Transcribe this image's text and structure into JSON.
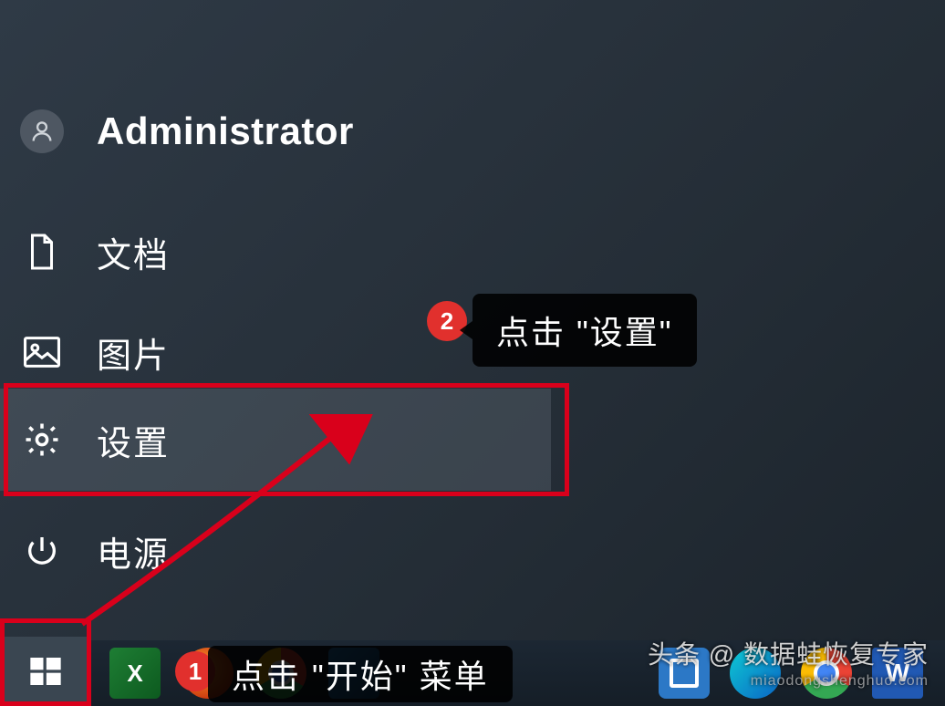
{
  "start_menu": {
    "user_label": "Administrator",
    "items": {
      "documents": "文档",
      "pictures": "图片",
      "settings": "设置",
      "power": "电源"
    }
  },
  "annotations": {
    "step1": {
      "number": "1",
      "text": "点击 \"开始\" 菜单"
    },
    "step2": {
      "number": "2",
      "text": "点击 \"设置\""
    },
    "highlight_color": "#d9001b"
  },
  "watermark": {
    "line1": "头条 @ 数据蛙恢复专家",
    "line2": "miaodongshenghuo.com"
  },
  "taskbar": {
    "apps": [
      "excel",
      "firefox",
      "chrome",
      "generic"
    ],
    "right_apps": [
      "file-explorer",
      "edge",
      "chrome",
      "word"
    ]
  }
}
